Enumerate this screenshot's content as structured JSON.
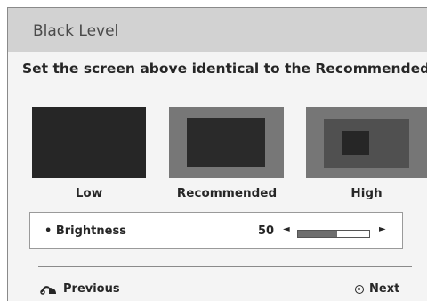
{
  "window": {
    "title": "Black Level"
  },
  "instruction": "Set the screen above identical to the Recommended sample below.",
  "samples": [
    {
      "label": "Low"
    },
    {
      "label": "Recommended"
    },
    {
      "label": "High"
    }
  ],
  "brightness": {
    "label": "• Brightness",
    "value": "50",
    "level_percent": 55
  },
  "footer": {
    "previous_label": "Previous",
    "next_label": "Next"
  },
  "colors": {
    "title_bar": "#d2d2d2",
    "panel_bg": "#f4f4f4",
    "text": "#262626"
  }
}
